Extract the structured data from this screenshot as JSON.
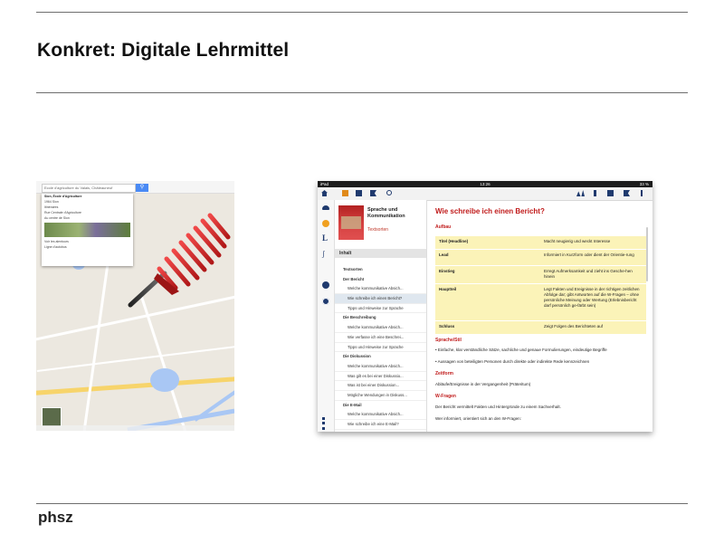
{
  "slide": {
    "title": "Konkret: Digitale Lehrmittel",
    "footer_logo": "phsz"
  },
  "map": {
    "search_placeholder": "Ecole d'agriculture du Valais, Châteauneuf",
    "panel_lines": [
      "Sion, École d'Agriculture",
      "1964 Sion",
      "Itinéraires",
      "Rue Centrale d'Agriculture",
      "Au centre de Sion",
      "Voir les alentours",
      "Ligne d'autobus",
      "A mi-distance - Restaurants - Cafés"
    ],
    "colors": {
      "road": "#f7d46b",
      "water": "#a9c7f4",
      "land": "#ece8e0"
    }
  },
  "ipad": {
    "status": {
      "device": "iPad",
      "time": "13:26",
      "battery": "33 %"
    },
    "book": {
      "title": "Sprache und Kommunikation",
      "subtitle": "Textsorten"
    },
    "toc_header": "Inhalt",
    "toc": [
      {
        "label": "Textsorten",
        "kind": "bold"
      },
      {
        "label": "Der Bericht",
        "kind": "bold"
      },
      {
        "label": "Welche kommunikative Absich...",
        "kind": "sub"
      },
      {
        "label": "Wie schreibe ich einen Bericht?",
        "kind": "sub sel"
      },
      {
        "label": "Tipps und Hinweise zur Sprache",
        "kind": "sub"
      },
      {
        "label": "Die Beschreibung",
        "kind": "bold"
      },
      {
        "label": "Welche kommunikative Absich...",
        "kind": "sub"
      },
      {
        "label": "Wie verfasse ich eine Beschrei...",
        "kind": "sub"
      },
      {
        "label": "Tipps und Hinweise zur Sprache",
        "kind": "sub"
      },
      {
        "label": "Die Diskussion",
        "kind": "bold"
      },
      {
        "label": "Welche kommunikative Absich...",
        "kind": "sub"
      },
      {
        "label": "Was gilt es bei einer Diskussio...",
        "kind": "sub"
      },
      {
        "label": "Was ist bei einer Diskussion...",
        "kind": "sub"
      },
      {
        "label": "Mögliche Wendungen in Diskuss...",
        "kind": "sub"
      },
      {
        "label": "Die E-Mail",
        "kind": "bold"
      },
      {
        "label": "Welche kommunikative Absich...",
        "kind": "sub"
      },
      {
        "label": "Wie schreibe ich eine E-Mail?",
        "kind": "sub"
      }
    ],
    "content": {
      "heading": "Wie schreibe ich einen Bericht?",
      "aufbau": "Aufbau",
      "table": [
        {
          "k": "Titel (Headline)",
          "v": "Macht neugierig und weckt Interesse"
        },
        {
          "k": "Lead",
          "v": "Informiert in Kurzform oder dient der Orientie-rung"
        },
        {
          "k": "Einstieg",
          "v": "Erregt Aufmerksamkeit und zieht ins Gesche-hen hinein"
        },
        {
          "k": "Hauptteil",
          "v": "Legt Fakten und Ereignisse in der richtigen zeitlichen Abfolge dar; gibt Antworten auf die W-Fragen – ohne persönliche Meinung oder Wertung (Erlebnisbericht darf persönlich ge-färbt sein)"
        },
        {
          "k": "Schluss",
          "v": "Zeigt Folgen des Berichteten auf"
        }
      ],
      "stil_heading": "Sprache/Stil",
      "stil_lines": [
        "• Einfache, klar verständliche Sätze, sachliche und genaue Formulierungen, eindeutige Begriffe",
        "• Aussagen von beteiligten Personen durch direkte oder indirekte Rede kennzeichnen"
      ],
      "zeit_heading": "Zeitform",
      "zeit_line": "Abläufe/Ereignisse in der Vergangenheit (Präteritum)",
      "wfragen_heading": "W-Fragen",
      "wfragen_lines": [
        "Der Bericht vermittelt Fakten und Hintergründe zu einem Sachverhalt.",
        "Wer informiert, orientiert sich an den W-Fragen:"
      ]
    }
  }
}
